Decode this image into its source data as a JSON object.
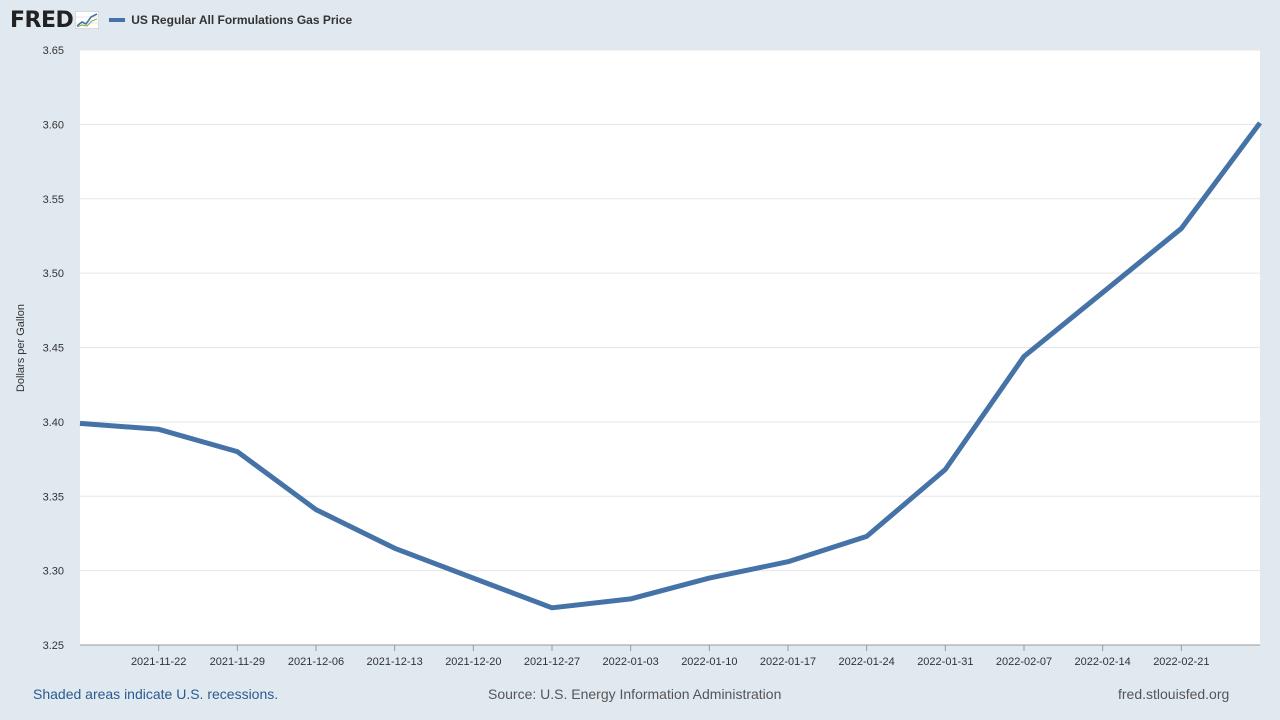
{
  "header": {
    "logo_text": "FRED",
    "legend_label": "US Regular All Formulations Gas Price"
  },
  "footer": {
    "recessions_note": "Shaded areas indicate U.S. recessions.",
    "source": "Source: U.S. Energy Information Administration",
    "site": "fred.stlouisfed.org"
  },
  "colors": {
    "series": "#4572a7",
    "background": "#e1e9f0",
    "plot": "#ffffff"
  },
  "chart_data": {
    "type": "line",
    "title": "",
    "xlabel": "",
    "ylabel": "Dollars per Gallon",
    "ylim": [
      3.25,
      3.65
    ],
    "yticks": [
      "3.25",
      "3.30",
      "3.35",
      "3.40",
      "3.45",
      "3.50",
      "3.55",
      "3.60",
      "3.65"
    ],
    "xticks": [
      "2021-11-22",
      "2021-11-29",
      "2021-12-06",
      "2021-12-13",
      "2021-12-20",
      "2021-12-27",
      "2022-01-03",
      "2022-01-10",
      "2022-01-17",
      "2022-01-24",
      "2022-01-31",
      "2022-02-07",
      "2022-02-14",
      "2022-02-21"
    ],
    "xlim": [
      "2021-11-15",
      "2022-02-28"
    ],
    "grid": true,
    "legend": "top-left",
    "series": [
      {
        "name": "US Regular All Formulations Gas Price",
        "x": [
          "2021-11-15",
          "2021-11-22",
          "2021-11-29",
          "2021-12-06",
          "2021-12-13",
          "2021-12-20",
          "2021-12-27",
          "2022-01-03",
          "2022-01-10",
          "2022-01-17",
          "2022-01-24",
          "2022-01-31",
          "2022-02-07",
          "2022-02-14",
          "2022-02-21",
          "2022-02-28"
        ],
        "values": [
          3.399,
          3.395,
          3.38,
          3.341,
          3.315,
          3.295,
          3.275,
          3.281,
          3.295,
          3.306,
          3.323,
          3.368,
          3.444,
          3.487,
          3.53,
          3.601
        ]
      }
    ]
  }
}
